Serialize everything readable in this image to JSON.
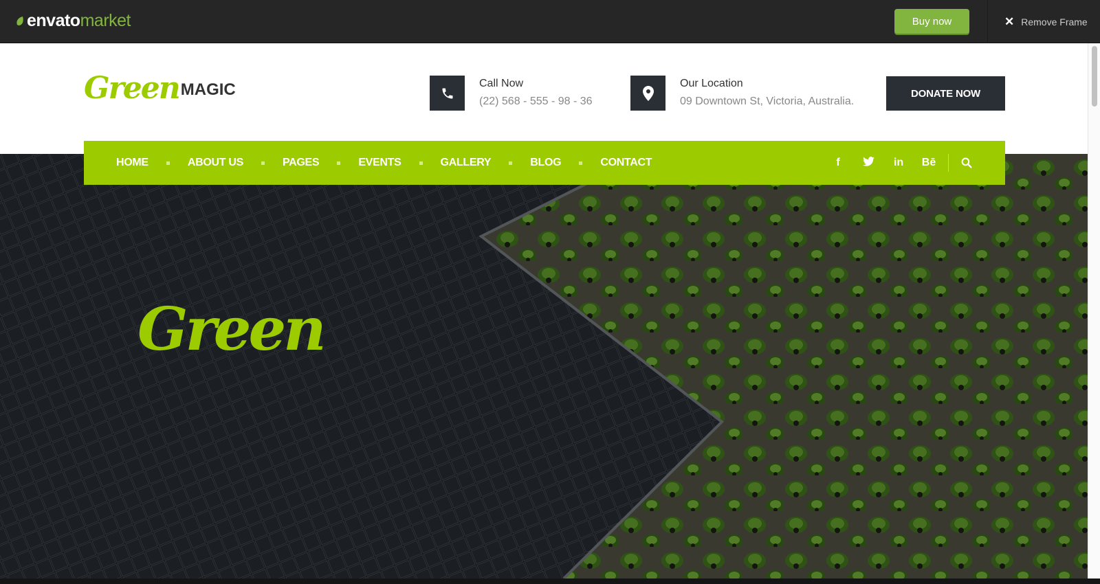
{
  "envato": {
    "logo_main": "envato",
    "logo_accent": "market",
    "buy_label": "Buy now",
    "remove_label": "Remove Frame"
  },
  "site": {
    "brand_green": "Green",
    "brand_magic": "MAGIC",
    "call": {
      "title": "Call Now",
      "value": "(22) 568 - 555 - 98 - 36"
    },
    "location": {
      "title": "Our Location",
      "value": "09 Downtown St, Victoria, Australia."
    },
    "donate_label": "DONATE NOW",
    "nav": [
      "HOME",
      "ABOUT US",
      "PAGES",
      "EVENTS",
      "GALLERY",
      "BLOG",
      "CONTACT"
    ],
    "social": [
      "f",
      "t",
      "in",
      "Bē"
    ],
    "hero_title": "Green"
  },
  "colors": {
    "accent": "#9ccc00",
    "envato_green": "#82b540",
    "dark": "#2a2f36",
    "envato_bar": "#262626"
  },
  "icons": {
    "call": "phone-icon",
    "location": "map-pin-icon",
    "search": "search-icon",
    "close": "close-icon"
  }
}
